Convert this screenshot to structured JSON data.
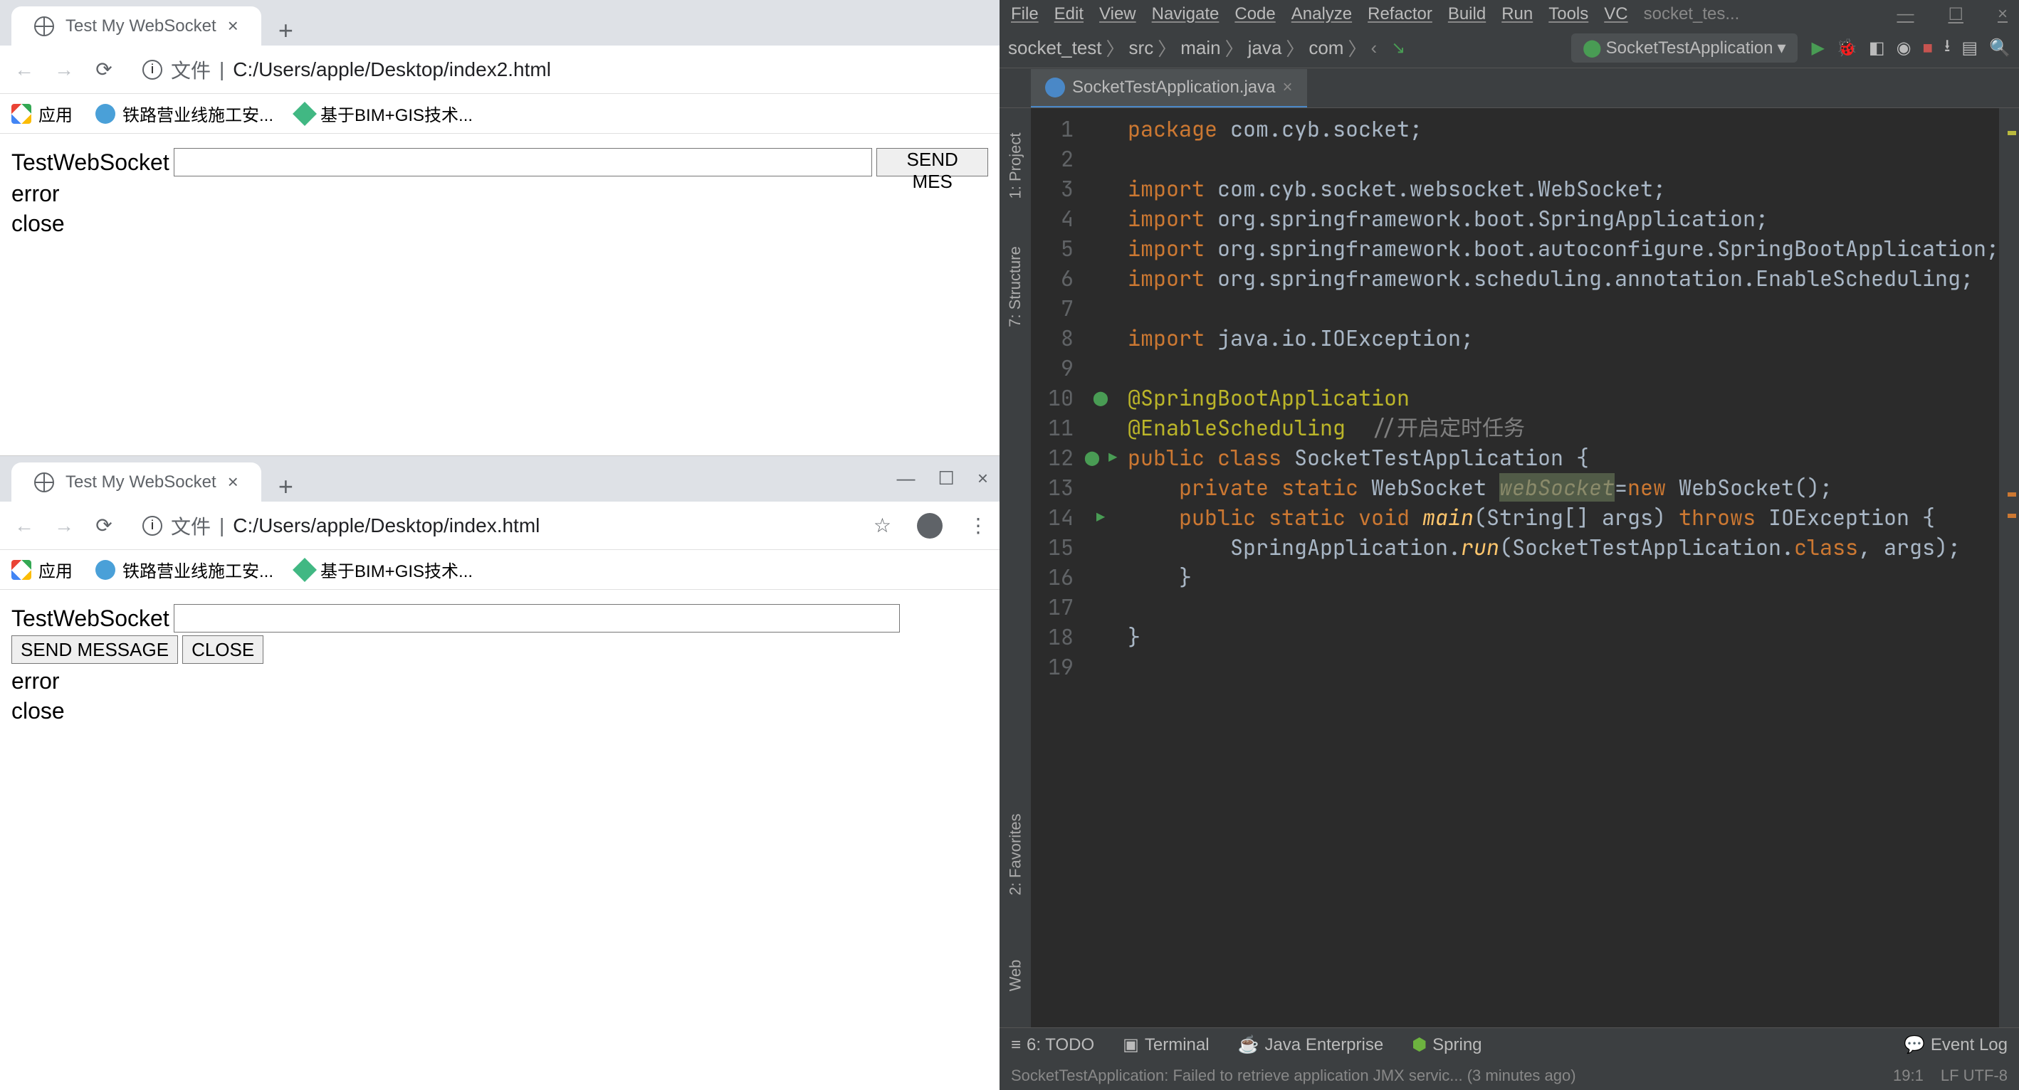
{
  "browser1": {
    "tab_title": "Test My WebSocket",
    "url_label": "文件",
    "url_path": "C:/Users/apple/Desktop/index2.html",
    "bookmarks": {
      "apps": "应用",
      "rail": "铁路营业线施工安...",
      "bim": "基于BIM+GIS技术..."
    },
    "page": {
      "title": "TestWebSocket",
      "send_btn": "SEND MES",
      "line1": "error",
      "line2": "close"
    }
  },
  "browser2": {
    "tab_title": "Test My WebSocket",
    "url_label": "文件",
    "url_path": "C:/Users/apple/Desktop/index.html",
    "bookmarks": {
      "apps": "应用",
      "rail": "铁路营业线施工安...",
      "bim": "基于BIM+GIS技术..."
    },
    "page": {
      "title": "TestWebSocket",
      "send_btn": "SEND MESSAGE",
      "close_btn": "CLOSE",
      "line1": "error",
      "line2": "close"
    }
  },
  "ide": {
    "menu": [
      "File",
      "Edit",
      "View",
      "Navigate",
      "Code",
      "Analyze",
      "Refactor",
      "Build",
      "Run",
      "Tools",
      "VC"
    ],
    "menu_trunc": "socket_tes...",
    "crumbs": [
      "socket_test",
      "src",
      "main",
      "java",
      "com"
    ],
    "run_config": "SocketTestApplication",
    "tab": "SocketTestApplication.java",
    "side": {
      "project": "1: Project",
      "structure": "7: Structure",
      "favorites": "2: Favorites",
      "web": "Web"
    },
    "code_lines": [
      {
        "n": 1,
        "html": "<span class='kw'>package</span> com.cyb.socket;"
      },
      {
        "n": 2,
        "html": ""
      },
      {
        "n": 3,
        "html": "<span class='kw'>import</span> com.cyb.socket.websocket.WebSocket;"
      },
      {
        "n": 4,
        "html": "<span class='kw'>import</span> org.springframework.boot.SpringApplication;"
      },
      {
        "n": 5,
        "html": "<span class='kw'>import</span> org.springframework.boot.autoconfigure.<span class='cls'>SpringBootApplication</span>;"
      },
      {
        "n": 6,
        "html": "<span class='kw'>import</span> org.springframework.scheduling.annotation.<span class='cls'>EnableScheduling</span>;"
      },
      {
        "n": 7,
        "html": ""
      },
      {
        "n": 8,
        "html": "<span class='kw'>import</span> java.io.IOException;"
      },
      {
        "n": 9,
        "html": ""
      },
      {
        "n": 10,
        "html": "<span class='ann'>@SpringBootApplication</span>"
      },
      {
        "n": 11,
        "html": "<span class='ann'>@EnableScheduling</span>  <span class='cmt'>//开启定时任务</span>"
      },
      {
        "n": 12,
        "html": "<span class='kw'>public class</span> SocketTestApplication {"
      },
      {
        "n": 13,
        "html": "    <span class='kw'>private static</span> WebSocket <span class='hl'>webSocket</span>=<span class='kw'>new</span> WebSocket();"
      },
      {
        "n": 14,
        "html": "    <span class='kw'>public static void</span> <span class='fn'>main</span>(String[] args) <span class='kw'>throws</span> IOException {"
      },
      {
        "n": 15,
        "html": "        SpringApplication.<span class='fn'>run</span>(SocketTestApplication.<span class='kw'>class</span>, args);"
      },
      {
        "n": 16,
        "html": "    }"
      },
      {
        "n": 17,
        "html": ""
      },
      {
        "n": 18,
        "html": "}"
      },
      {
        "n": 19,
        "html": ""
      }
    ],
    "bottom": {
      "todo": "6: TODO",
      "terminal": "Terminal",
      "java_ee": "Java Enterprise",
      "spring": "Spring",
      "event_log": "Event Log"
    },
    "status": {
      "msg": "SocketTestApplication: Failed to retrieve application JMX servic... (3 minutes ago)",
      "pos": "19:1",
      "enc": "LF  UTF-8",
      "sp": "..."
    }
  }
}
